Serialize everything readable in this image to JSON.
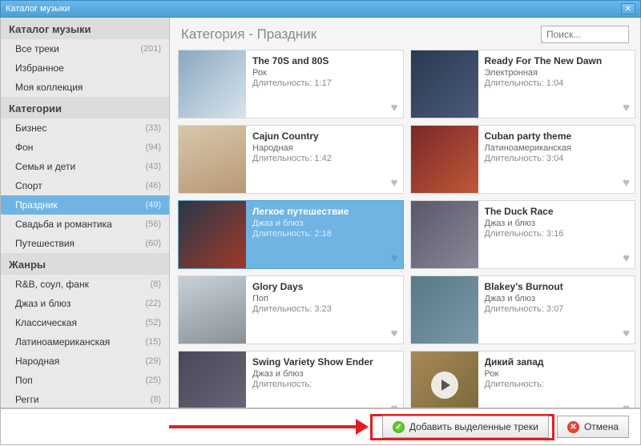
{
  "window": {
    "title": "Каталог музыки"
  },
  "search": {
    "placeholder": "Поиск..."
  },
  "main": {
    "heading": "Категория - Праздник",
    "duration_prefix": "Длительность:"
  },
  "sidebar": {
    "groups": [
      {
        "title": "Каталог музыки",
        "items": [
          {
            "label": "Все треки",
            "count": "(201)"
          },
          {
            "label": "Избранное"
          },
          {
            "label": "Моя коллекция"
          }
        ]
      },
      {
        "title": "Категории",
        "items": [
          {
            "label": "Бизнес",
            "count": "(33)"
          },
          {
            "label": "Фон",
            "count": "(94)"
          },
          {
            "label": "Семья и дети",
            "count": "(43)"
          },
          {
            "label": "Спорт",
            "count": "(46)"
          },
          {
            "label": "Праздник",
            "count": "(49)",
            "selected": true
          },
          {
            "label": "Свадьба и романтика",
            "count": "(56)"
          },
          {
            "label": "Путешествия",
            "count": "(60)"
          }
        ]
      },
      {
        "title": "Жанры",
        "items": [
          {
            "label": "R&B, соул, фанк",
            "count": "(8)"
          },
          {
            "label": "Джаз и блюз",
            "count": "(22)"
          },
          {
            "label": "Классическая",
            "count": "(52)"
          },
          {
            "label": "Латиноамериканская",
            "count": "(15)"
          },
          {
            "label": "Народная",
            "count": "(29)"
          },
          {
            "label": "Поп",
            "count": "(25)"
          },
          {
            "label": "Регги",
            "count": "(8)"
          }
        ]
      }
    ]
  },
  "tracks": [
    {
      "title": "The 70S and 80S",
      "genre": "Рок",
      "duration": "1:17",
      "thumb": "th1"
    },
    {
      "title": "Ready For The New Dawn",
      "genre": "Электронная",
      "duration": "1:04",
      "thumb": "th2"
    },
    {
      "title": "Cajun Country",
      "genre": "Народная",
      "duration": "1:42",
      "thumb": "th3"
    },
    {
      "title": "Cuban party theme",
      "genre": "Латиноамериканская",
      "duration": "3:04",
      "thumb": "th4"
    },
    {
      "title": "Легкое путешествие",
      "genre": "Джаз и блюз",
      "duration": "2:18",
      "thumb": "th5",
      "selected": true
    },
    {
      "title": "The Duck Race",
      "genre": "Джаз и блюз",
      "duration": "3:16",
      "thumb": "th6"
    },
    {
      "title": "Glory Days",
      "genre": "Поп",
      "duration": "3:23",
      "thumb": "th7"
    },
    {
      "title": "Blakey's Burnout",
      "genre": "Джаз и блюз",
      "duration": "3:07",
      "thumb": "th8"
    },
    {
      "title": "Swing Variety Show Ender",
      "genre": "Джаз и блюз",
      "duration": "",
      "thumb": "th9"
    },
    {
      "title": "Дикий запад",
      "genre": "Рок",
      "duration": "",
      "thumb": "th10",
      "play": true
    }
  ],
  "footer": {
    "primary": "Добавить выделенные треки",
    "cancel": "Отмена"
  }
}
